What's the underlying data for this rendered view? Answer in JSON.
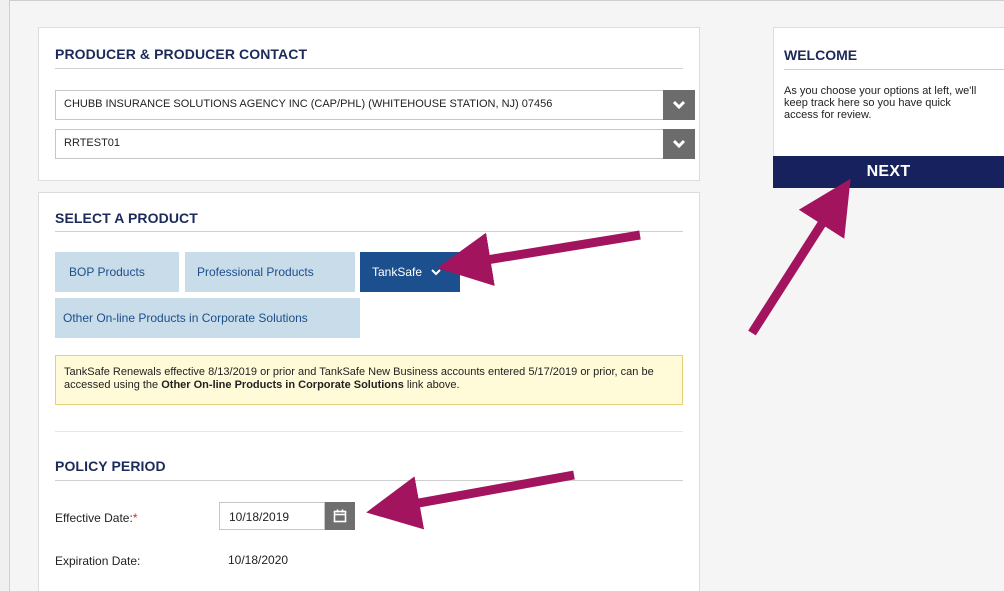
{
  "producer": {
    "title": "PRODUCER & PRODUCER CONTACT",
    "agency_value": "CHUBB INSURANCE SOLUTIONS AGENCY INC (CAP/PHL)  (WHITEHOUSE STATION, NJ) 07456",
    "contact_value": "RRTEST01"
  },
  "product": {
    "title": "SELECT A PRODUCT",
    "tabs": [
      {
        "label": "BOP Products",
        "active": false
      },
      {
        "label": "Professional Products",
        "active": false
      },
      {
        "label": "TankSafe",
        "active": true
      },
      {
        "label": "Other On-line Products in Corporate Solutions",
        "active": false
      }
    ],
    "notice": {
      "text_before": "TankSafe Renewals effective 8/13/2019 or prior and TankSafe New Business accounts entered 5/17/2019 or prior, can be accessed using the ",
      "link_text": "Other On-line Products in Corporate Solutions",
      "text_after": " link above."
    }
  },
  "policy": {
    "title": "POLICY PERIOD",
    "effective_label": "Effective Date:",
    "required_mark": "*",
    "effective_value": "10/18/2019",
    "expiration_label": "Expiration Date:",
    "expiration_value": "10/18/2020"
  },
  "welcome": {
    "title": "WELCOME",
    "text": "As you choose your options at left, we'll keep track here so you have quick access for review.",
    "next_label": "NEXT"
  },
  "colors": {
    "arrow": "#a3145f",
    "tab_active": "#1b4f8e",
    "tab_inactive": "#c8dcea",
    "next_bg": "#17215d"
  },
  "icons": [
    "chevron-down-icon",
    "calendar-icon"
  ]
}
